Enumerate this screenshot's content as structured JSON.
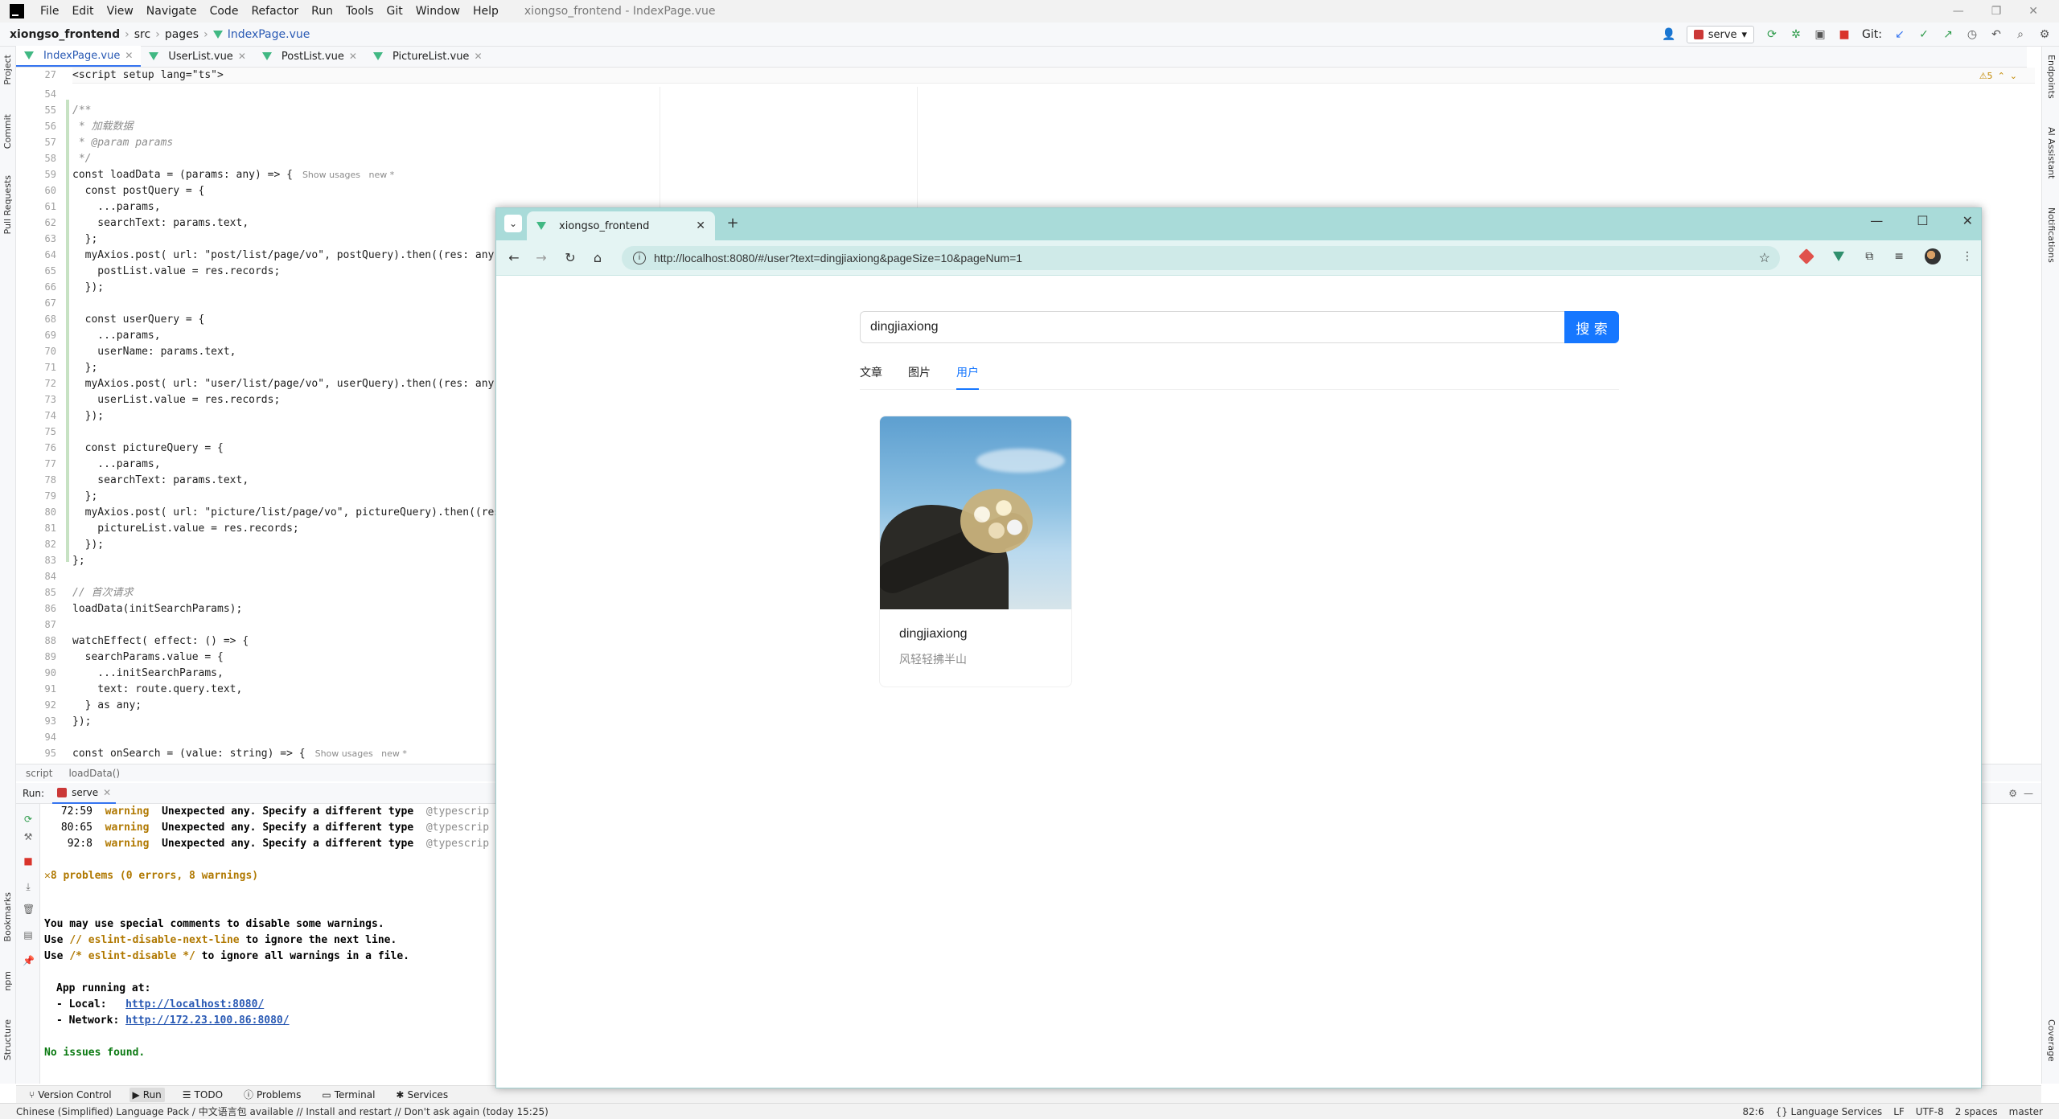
{
  "ide": {
    "menu": [
      "File",
      "Edit",
      "View",
      "Navigate",
      "Code",
      "Refactor",
      "Run",
      "Tools",
      "Git",
      "Window",
      "Help"
    ],
    "window_title": "xiongso_frontend - IndexPage.vue",
    "breadcrumb": [
      "xiongso_frontend",
      "src",
      "pages",
      "IndexPage.vue"
    ],
    "run_config": "serve",
    "git_label": "Git:",
    "tabs": [
      "IndexPage.vue",
      "UserList.vue",
      "PostList.vue",
      "PictureList.vue"
    ],
    "left_tools": [
      "Project",
      "Commit",
      "Pull Requests",
      "Bookmarks",
      "npm",
      "Structure"
    ],
    "right_tools": [
      "Endpoints",
      "AI Assistant",
      "Notifications",
      "Coverage"
    ],
    "inspection": "⚠5",
    "sticky_line": {
      "number": "27",
      "text": "<script setup lang=\"ts\">"
    },
    "code_lines": [
      {
        "n": "54",
        "t": ""
      },
      {
        "n": "55",
        "t": "/**"
      },
      {
        "n": "56",
        "t": " * 加载数据"
      },
      {
        "n": "57",
        "t": " * @param params"
      },
      {
        "n": "58",
        "t": " */"
      },
      {
        "n": "59",
        "t": "const loadData = (params: any) => {",
        "hint": "Show usages   new *"
      },
      {
        "n": "60",
        "t": "  const postQuery = {"
      },
      {
        "n": "61",
        "t": "    ...params,"
      },
      {
        "n": "62",
        "t": "    searchText: params.text,"
      },
      {
        "n": "63",
        "t": "  };"
      },
      {
        "n": "64",
        "t": "  myAxios.post( url: \"post/list/page/vo\", postQuery).then((res: any)"
      },
      {
        "n": "65",
        "t": "    postList.value = res.records;"
      },
      {
        "n": "66",
        "t": "  });"
      },
      {
        "n": "67",
        "t": ""
      },
      {
        "n": "68",
        "t": "  const userQuery = {"
      },
      {
        "n": "69",
        "t": "    ...params,"
      },
      {
        "n": "70",
        "t": "    userName: params.text,"
      },
      {
        "n": "71",
        "t": "  };"
      },
      {
        "n": "72",
        "t": "  myAxios.post( url: \"user/list/page/vo\", userQuery).then((res: any)"
      },
      {
        "n": "73",
        "t": "    userList.value = res.records;"
      },
      {
        "n": "74",
        "t": "  });"
      },
      {
        "n": "75",
        "t": ""
      },
      {
        "n": "76",
        "t": "  const pictureQuery = {"
      },
      {
        "n": "77",
        "t": "    ...params,"
      },
      {
        "n": "78",
        "t": "    searchText: params.text,"
      },
      {
        "n": "79",
        "t": "  };"
      },
      {
        "n": "80",
        "t": "  myAxios.post( url: \"picture/list/page/vo\", pictureQuery).then((res"
      },
      {
        "n": "81",
        "t": "    pictureList.value = res.records;"
      },
      {
        "n": "82",
        "t": "  });"
      },
      {
        "n": "83",
        "t": "};"
      },
      {
        "n": "84",
        "t": ""
      },
      {
        "n": "85",
        "t": "// 首次请求"
      },
      {
        "n": "86",
        "t": "loadData(initSearchParams);"
      },
      {
        "n": "87",
        "t": ""
      },
      {
        "n": "88",
        "t": "watchEffect( effect: () => {"
      },
      {
        "n": "89",
        "t": "  searchParams.value = {"
      },
      {
        "n": "90",
        "t": "    ...initSearchParams,"
      },
      {
        "n": "91",
        "t": "    text: route.query.text,"
      },
      {
        "n": "92",
        "t": "  } as any;"
      },
      {
        "n": "93",
        "t": "});"
      },
      {
        "n": "94",
        "t": ""
      },
      {
        "n": "95",
        "t": "const onSearch = (value: string) => {",
        "hint": "Show usages   new *"
      }
    ],
    "editor_breadcrumb": [
      "script",
      "loadData()"
    ],
    "run_label": "Run:",
    "run_tab": "serve",
    "console": {
      "warnings": [
        {
          "pos": "72:59",
          "level": "warning",
          "msg": "Unexpected any. Specify a different type",
          "rule": "@typescrip"
        },
        {
          "pos": "80:65",
          "level": "warning",
          "msg": "Unexpected any. Specify a different type",
          "rule": "@typescrip"
        },
        {
          "pos": "92:8",
          "level": "warning",
          "msg": "Unexpected any. Specify a different type",
          "rule": "@typescrip"
        }
      ],
      "problems": "✕8 problems (0 errors, 8 warnings)",
      "hint1": "You may use special comments to disable some warnings.",
      "hint2_a": "Use ",
      "hint2_b": "// eslint-disable-next-line",
      "hint2_c": " to ignore the next line.",
      "hint3_a": "Use ",
      "hint3_b": "/* eslint-disable */",
      "hint3_c": " to ignore all warnings in a file.",
      "app_running": "App running at:",
      "local_label": "- Local:   ",
      "local_url": "http://localhost:8080/",
      "network_label": "- Network: ",
      "network_url": "http://172.23.100.86:8080/",
      "no_issues": "No issues found."
    },
    "tool_tabs": [
      "Version Control",
      "Run",
      "TODO",
      "Problems",
      "Terminal",
      "Services"
    ],
    "status_msg": "Chinese (Simplified) Language Pack / 中文语言包 available // Install and restart // Don't ask again (today 15:25)",
    "status_right": [
      "82:6",
      "{} Language Services",
      "LF",
      "UTF-8",
      "2 spaces",
      "master"
    ]
  },
  "browser": {
    "tab_title": "xiongso_frontend",
    "url": "http://localhost:8080/#/user?text=dingjiaxiong&pageSize=10&pageNum=1"
  },
  "page": {
    "search_value": "dingjiaxiong",
    "search_button": "搜 索",
    "tabs": [
      "文章",
      "图片",
      "用户"
    ],
    "active_tab": "用户",
    "user": {
      "name": "dingjiaxiong",
      "profile": "风轻轻拂半山"
    }
  }
}
